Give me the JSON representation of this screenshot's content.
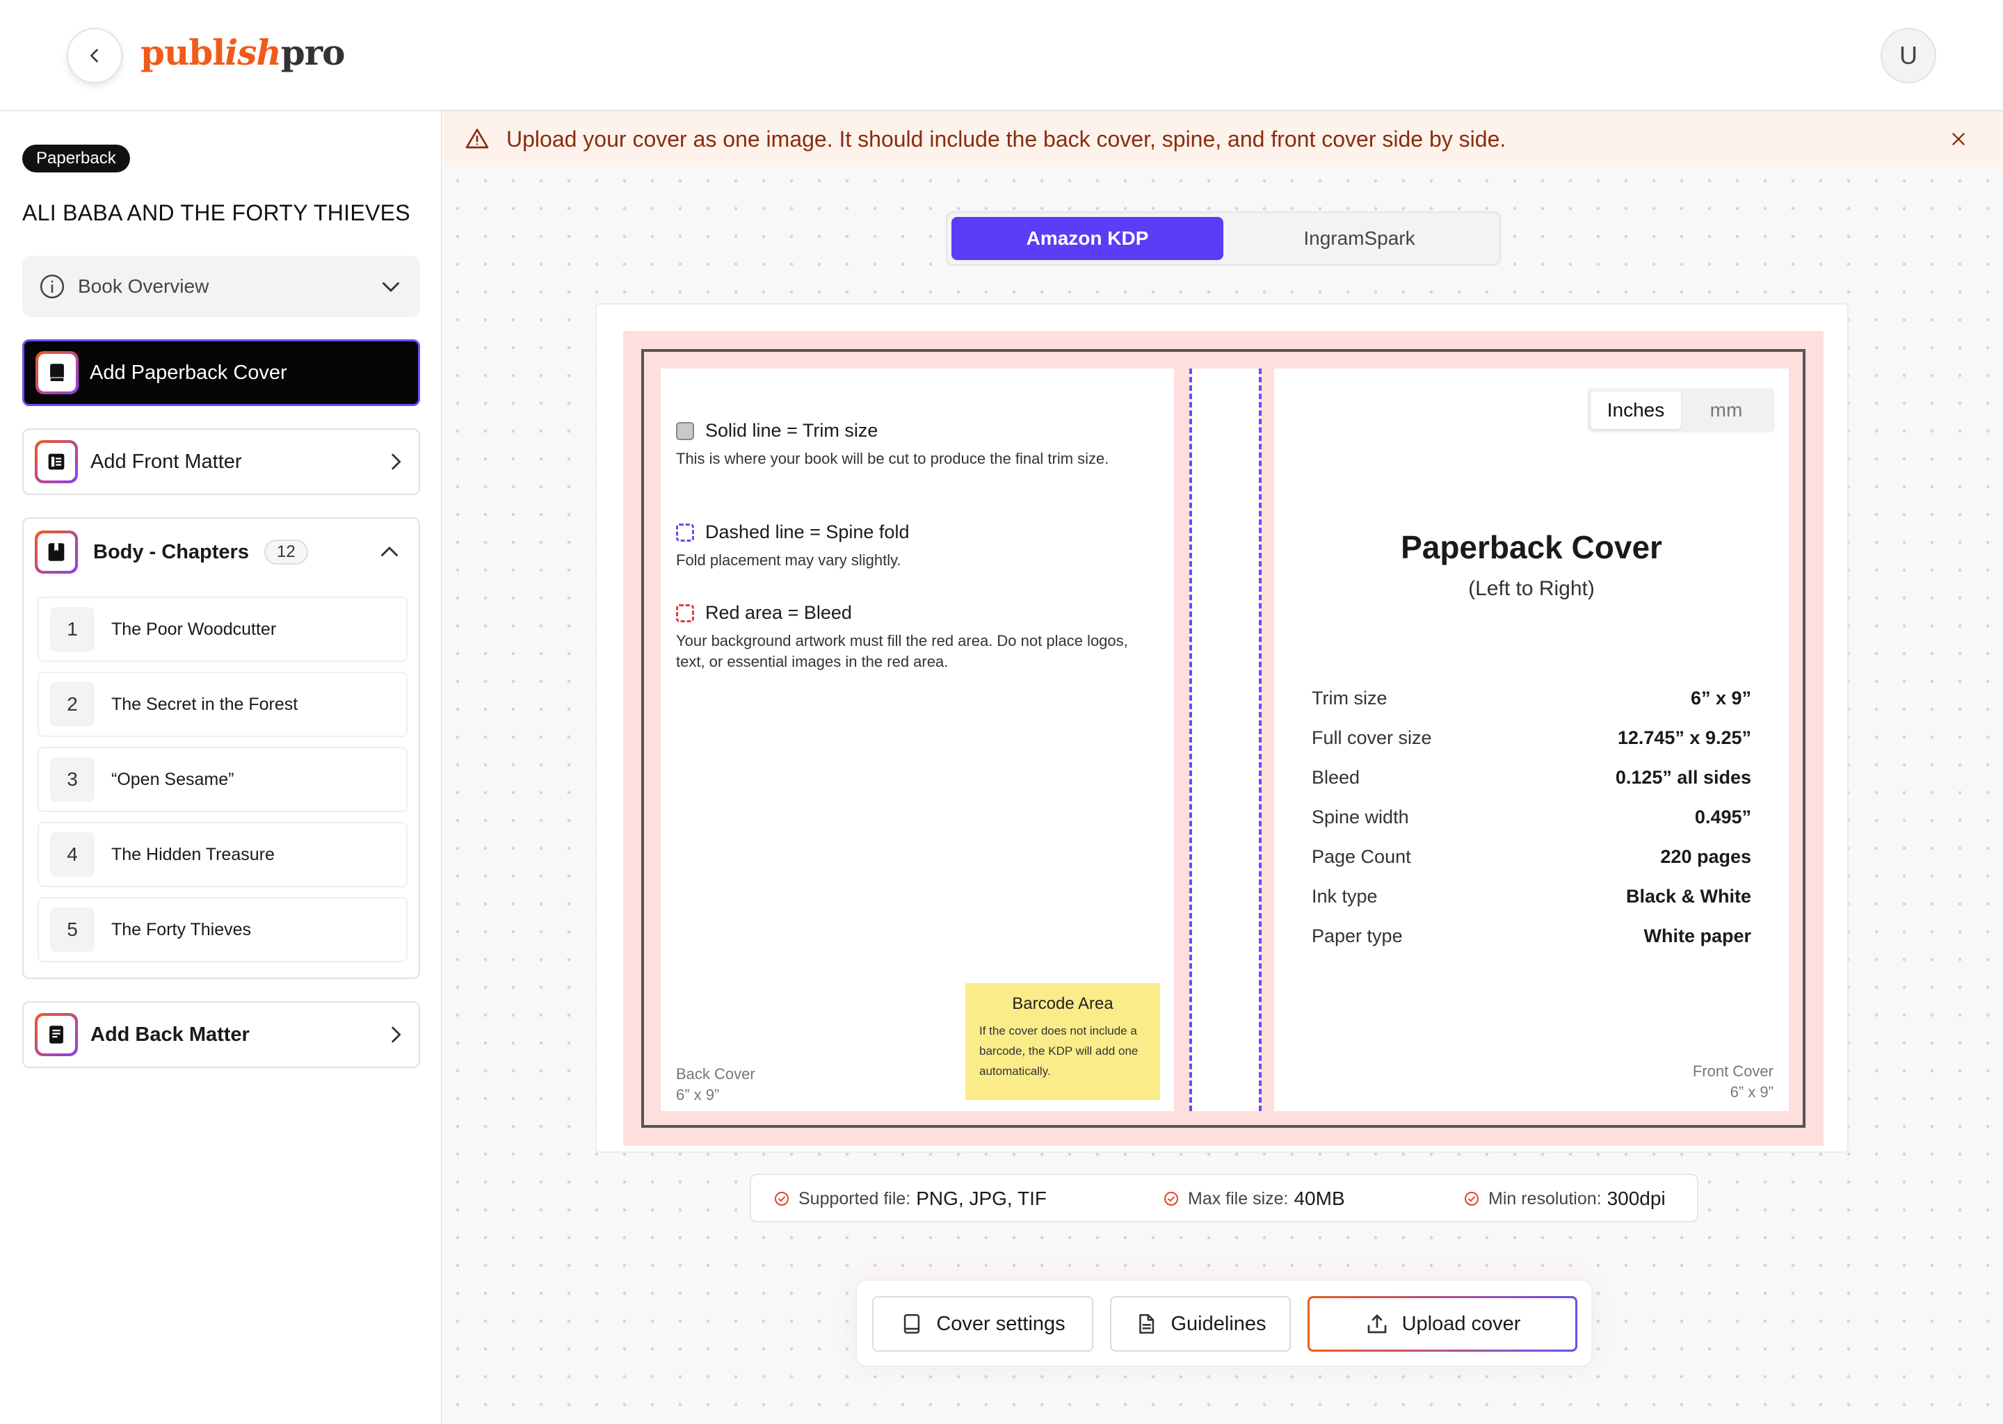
{
  "header": {
    "logo": {
      "part1": "publ",
      "part2": "ish",
      "part3": "pro"
    },
    "avatar_initial": "U"
  },
  "sidebar": {
    "format_badge": "Paperback",
    "book_title": "ALI BABA AND THE FORTY THIEVES",
    "overview_label": "Book Overview",
    "add_cover_label": "Add Paperback Cover",
    "add_front_matter_label": "Add Front Matter",
    "body_label": "Body - Chapters",
    "chapter_count": "12",
    "chapters": [
      {
        "num": "1",
        "title": "The Poor Woodcutter"
      },
      {
        "num": "2",
        "title": "The Secret in the Forest"
      },
      {
        "num": "3",
        "title": "“Open Sesame”"
      },
      {
        "num": "4",
        "title": "The Hidden Treasure"
      },
      {
        "num": "5",
        "title": "The Forty Thieves"
      }
    ],
    "add_back_matter_label": "Add Back Matter"
  },
  "banner": {
    "message": "Upload your cover as one image. It should include the back cover, spine, and front cover side by side."
  },
  "platform_toggle": {
    "options": [
      "Amazon KDP",
      "IngramSpark"
    ],
    "selected": "Amazon KDP"
  },
  "template": {
    "legend": [
      {
        "title": "Solid line = Trim size",
        "desc": "This is where your book will be cut to produce the final trim size."
      },
      {
        "title": "Dashed line = Spine fold",
        "desc": "Fold placement may vary slightly."
      },
      {
        "title": "Red area = Bleed",
        "desc": "Your background artwork must fill the red area. Do not place logos, text, or essential images in the red area."
      }
    ],
    "back_cover_label": "Back Cover",
    "back_cover_size": "6” x 9”",
    "barcode": {
      "title": "Barcode Area",
      "desc": "If the cover does not include a barcode, the KDP will add one automatically."
    },
    "units": [
      "Inches",
      "mm"
    ],
    "selected_unit": "Inches",
    "cover_title": "Paperback Cover",
    "cover_subtitle": "(Left to Right)",
    "specs": [
      {
        "label": "Trim size",
        "value": "6” x 9”"
      },
      {
        "label": "Full cover size",
        "value": "12.745” x  9.25”"
      },
      {
        "label": "Bleed",
        "value": "0.125” all sides"
      },
      {
        "label": "Spine width",
        "value": "0.495”"
      },
      {
        "label": "Page Count",
        "value": "220 pages"
      },
      {
        "label": "Ink type",
        "value": "Black & White"
      },
      {
        "label": "Paper type",
        "value": "White paper"
      }
    ],
    "front_cover_label": "Front Cover",
    "front_cover_size": "6” x 9”"
  },
  "requirements": [
    {
      "label": "Supported file:",
      "value": "PNG, JPG, TIF"
    },
    {
      "label": "Max file size:",
      "value": "40MB"
    },
    {
      "label": "Min resolution:",
      "value": "300dpi"
    }
  ],
  "actions": {
    "cover_settings": "Cover settings",
    "guidelines": "Guidelines",
    "upload_cover": "Upload cover"
  },
  "colors": {
    "brand_orange": "#f05a1a",
    "accent_purple": "#5b3df5",
    "bleed_red": "#ffdede",
    "barcode_yellow": "#fbec8a",
    "banner_bg": "#fdf2ec"
  }
}
